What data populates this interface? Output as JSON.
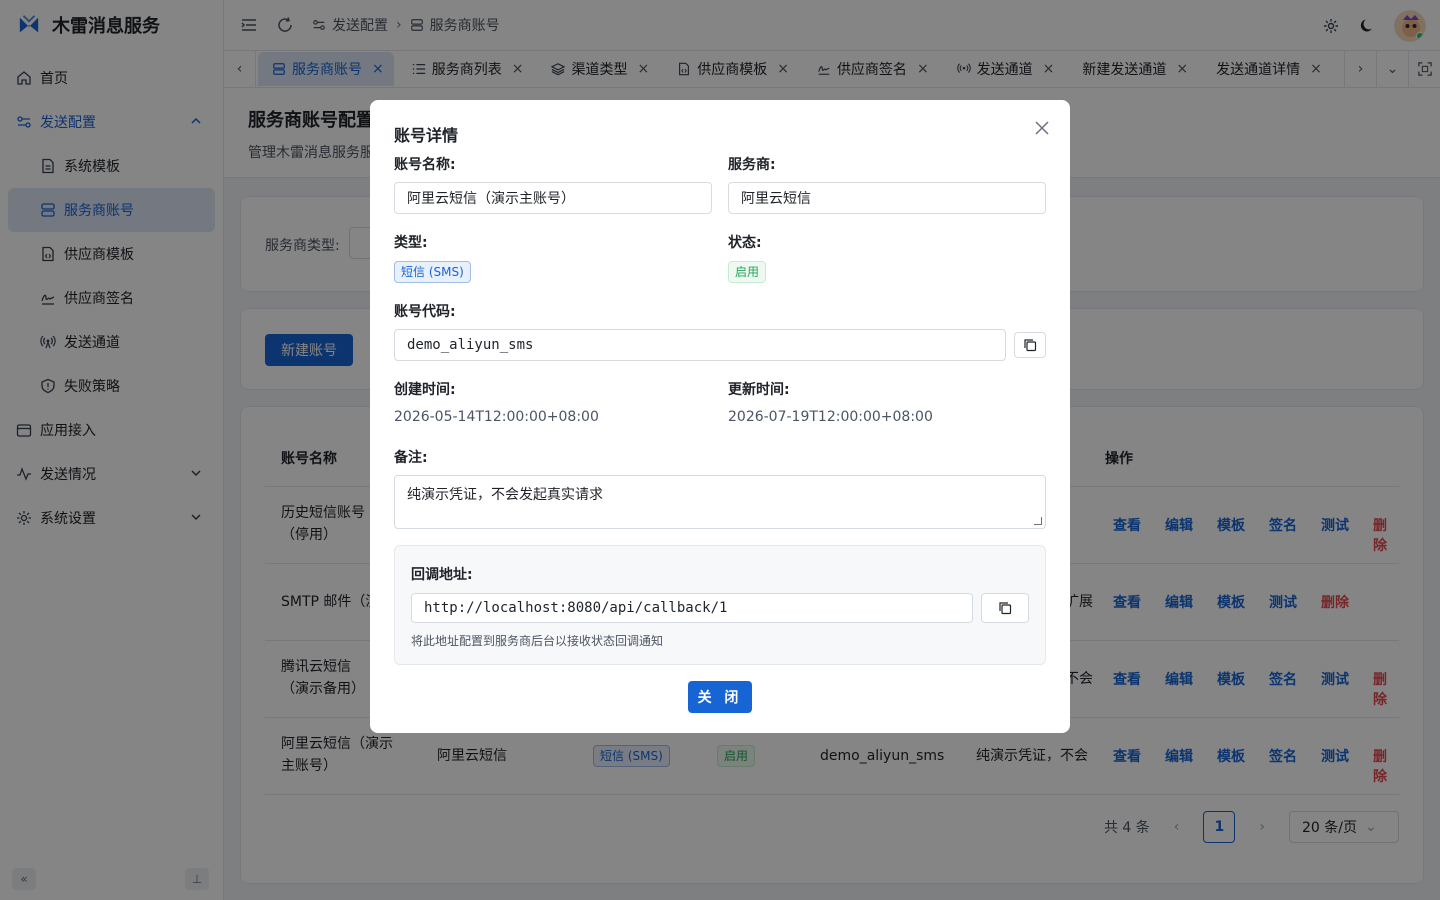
{
  "app": {
    "name": "木雷消息服务"
  },
  "sidebar": {
    "items": [
      {
        "label": "首页"
      },
      {
        "label": "发送配置"
      },
      {
        "label": "系统模板"
      },
      {
        "label": "服务商账号"
      },
      {
        "label": "供应商模板"
      },
      {
        "label": "供应商签名"
      },
      {
        "label": "发送通道"
      },
      {
        "label": "失败策略"
      },
      {
        "label": "应用接入"
      },
      {
        "label": "发送情况"
      },
      {
        "label": "系统设置"
      }
    ]
  },
  "header": {
    "breadcrumb": [
      "发送配置",
      "服务商账号"
    ]
  },
  "tabs": [
    {
      "label": "服务商账号",
      "active": true
    },
    {
      "label": "服务商列表"
    },
    {
      "label": "渠道类型"
    },
    {
      "label": "供应商模板"
    },
    {
      "label": "供应商签名"
    },
    {
      "label": "发送通道"
    },
    {
      "label": "新建发送通道"
    },
    {
      "label": "发送通道详情"
    }
  ],
  "page": {
    "title": "服务商账号配置",
    "desc": "管理木雷消息服务服",
    "filter_label": "服务商类型:",
    "new_button": "新建账号",
    "table_header": {
      "name": "账号名称",
      "ops": "操作"
    },
    "rows": [
      {
        "name": "历史短信账号（停用）",
        "ops": [
          "查看",
          "编辑",
          "模板",
          "签名",
          "测试",
          "删除"
        ]
      },
      {
        "name": "SMTP 邮件（演",
        "note": "扩展",
        "ops": [
          "查看",
          "编辑",
          "模板",
          "测试",
          "删除"
        ]
      },
      {
        "name": "腾讯云短信（演示备用）",
        "note": "不会",
        "ops": [
          "查看",
          "编辑",
          "模板",
          "签名",
          "测试",
          "删除"
        ]
      },
      {
        "name": "阿里云短信（演示主账号）",
        "provider": "阿里云短信",
        "type": "短信 (SMS)",
        "status": "启用",
        "code": "demo_aliyun_sms",
        "note": "纯演示凭证，不会",
        "ops": [
          "查看",
          "编辑",
          "模板",
          "签名",
          "测试",
          "删除"
        ]
      }
    ],
    "pager": {
      "total": "共 4 条",
      "page": "1",
      "size": "20 条/页"
    }
  },
  "modal": {
    "title": "账号详情",
    "name_label": "账号名称:",
    "name_value": "阿里云短信（演示主账号）",
    "provider_label": "服务商:",
    "provider_value": "阿里云短信",
    "type_label": "类型:",
    "type_value": "短信 (SMS)",
    "status_label": "状态:",
    "status_value": "启用",
    "code_label": "账号代码:",
    "code_value": "demo_aliyun_sms",
    "created_label": "创建时间:",
    "created_value": "2026-05-14T12:00:00+08:00",
    "updated_label": "更新时间:",
    "updated_value": "2026-07-19T12:00:00+08:00",
    "remark_label": "备注:",
    "remark_value": "纯演示凭证，不会发起真实请求",
    "callback_label": "回调地址:",
    "callback_value": "http://localhost:8080/api/callback/1",
    "callback_hint": "将此地址配置到服务商后台以接收状态回调通知",
    "close_button": "关 闭"
  },
  "colors": {
    "primary": "#1765d5",
    "danger": "#e5484d",
    "success": "#26a65b"
  }
}
